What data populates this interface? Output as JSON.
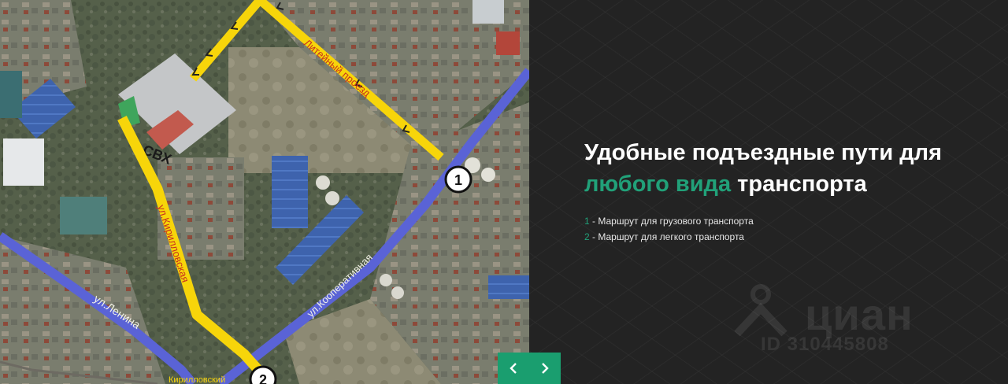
{
  "map": {
    "building_label": "СВХ",
    "road_lenina": "ул.Ленина",
    "road_kirillovskaya": "ул.Кирилловская",
    "road_kooperativnaya": "ул.Кооперативная",
    "road_liteyny": "Литейный проезд",
    "road_bottom": "Кирилловский",
    "marker_1": "1",
    "marker_2": "2",
    "route_truck_color": "#f7d50a",
    "route_car_color": "#5a63d6"
  },
  "info": {
    "headline_line1": "Удобные подъездные пути для",
    "headline_accent": "любого вида",
    "headline_rest": " транспорта",
    "accent_color": "#21a179",
    "routes": [
      {
        "number": "1",
        "text": " - Маршрут для грузового транспорта"
      },
      {
        "number": "2",
        "text": " - Маршрут для легкого транспорта"
      }
    ]
  },
  "watermark": {
    "brand": "циан",
    "id": "ID 310445808",
    "icon": "map-pin-icon"
  },
  "slider": {
    "prev_icon": "chevron-left-icon",
    "next_icon": "chevron-right-icon"
  }
}
